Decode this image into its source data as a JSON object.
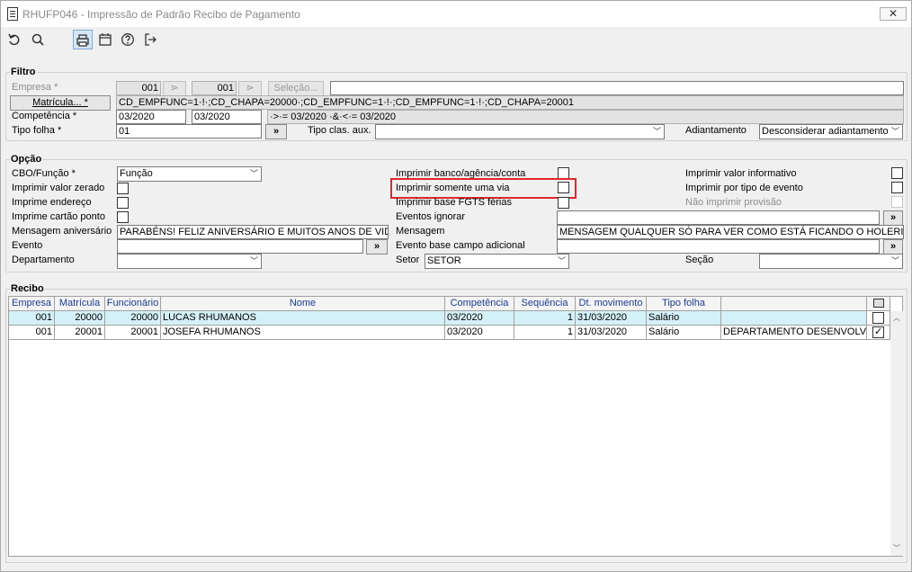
{
  "window": {
    "title": "RHUFP046 - Impressão de Padrão Recibo de Pagamento",
    "close": "✕"
  },
  "toolbar": {
    "undo": "undo-icon",
    "search": "search-icon",
    "print": "print-icon",
    "calendar": "calendar-icon",
    "help": "help-icon",
    "exit": "exit-icon"
  },
  "filtro": {
    "title": "Filtro",
    "empresa_label": "Empresa *",
    "empresa_from": "001",
    "empresa_to": "001",
    "selecao_label": "Seleção...",
    "matricula_button": "Matrícula... *",
    "matricula_value": "CD_EMPFUNC=1·!·;CD_CHAPA=20000·;CD_EMPFUNC=1·!·;CD_EMPFUNC=1·!·;CD_CHAPA=20001",
    "competencia_label": "Competência *",
    "competencia_from": "03/2020",
    "competencia_to": "03/2020",
    "competencia_expr": "·>·= 03/2020 ·&·<·= 03/2020",
    "tipo_folha_label": "Tipo folha *",
    "tipo_folha_value": "01",
    "go_button": "»",
    "tipo_clas_label": "Tipo clas. aux.",
    "tipo_clas_value": "",
    "adiantamento_label": "Adiantamento",
    "adiantamento_value": "Desconsiderar adiantamento"
  },
  "opcao": {
    "title": "Opção",
    "cbo_label": "CBO/Função *",
    "cbo_value": "Função",
    "valor_zerado_label": "Imprimir valor zerado",
    "endereco_label": "Imprime endereço",
    "cartao_label": "Imprime cartão ponto",
    "msg_aniv_label": "Mensagem aniversário",
    "msg_aniv_value": "PARABÉNS! FELIZ ANIVERSÁRIO E MUITOS ANOS DE VIDA",
    "evento_label": "Evento",
    "departamento_label": "Departamento",
    "banco_label": "Imprimir banco/agência/conta",
    "uma_via_label": "Imprimir somente uma via",
    "fgts_label": "Imprimir base FGTS férias",
    "eventos_ign_label": "Eventos ignorar",
    "mensagem_label": "Mensagem",
    "mensagem_value": "MENSAGEM QUALQUER SÓ PARA VER COMO ESTÁ FICANDO O HOLERITE COM",
    "evento_base_label": "Evento base campo adicional",
    "setor_label": "Setor",
    "setor_value": "SETOR",
    "valor_info_label": "Imprimir valor informativo",
    "tipo_evento_label": "Imprimir por tipo de evento",
    "nao_provisao_label": "Não imprimir provisão",
    "secao_label": "Seção"
  },
  "recibo": {
    "title": "Recibo",
    "columns": [
      "Empresa",
      "Matrícula",
      "Funcionário",
      "Nome",
      "Competência",
      "Sequência",
      "Dt. movimento",
      "Tipo folha",
      ""
    ],
    "rows": [
      {
        "empresa": "001",
        "matricula": "20000",
        "funcionario": "20000",
        "nome": "LUCAS RHUMANOS",
        "competencia": "03/2020",
        "sequencia": "1",
        "dt_movimento": "31/03/2020",
        "tipo_folha": "Salário",
        "extra": "",
        "checked": false
      },
      {
        "empresa": "001",
        "matricula": "20001",
        "funcionario": "20001",
        "nome": "JOSEFA RHUMANOS",
        "competencia": "03/2020",
        "sequencia": "1",
        "dt_movimento": "31/03/2020",
        "tipo_folha": "Salário",
        "extra": "DEPARTAMENTO DESENVOLVIMENTO",
        "checked": true
      }
    ]
  }
}
